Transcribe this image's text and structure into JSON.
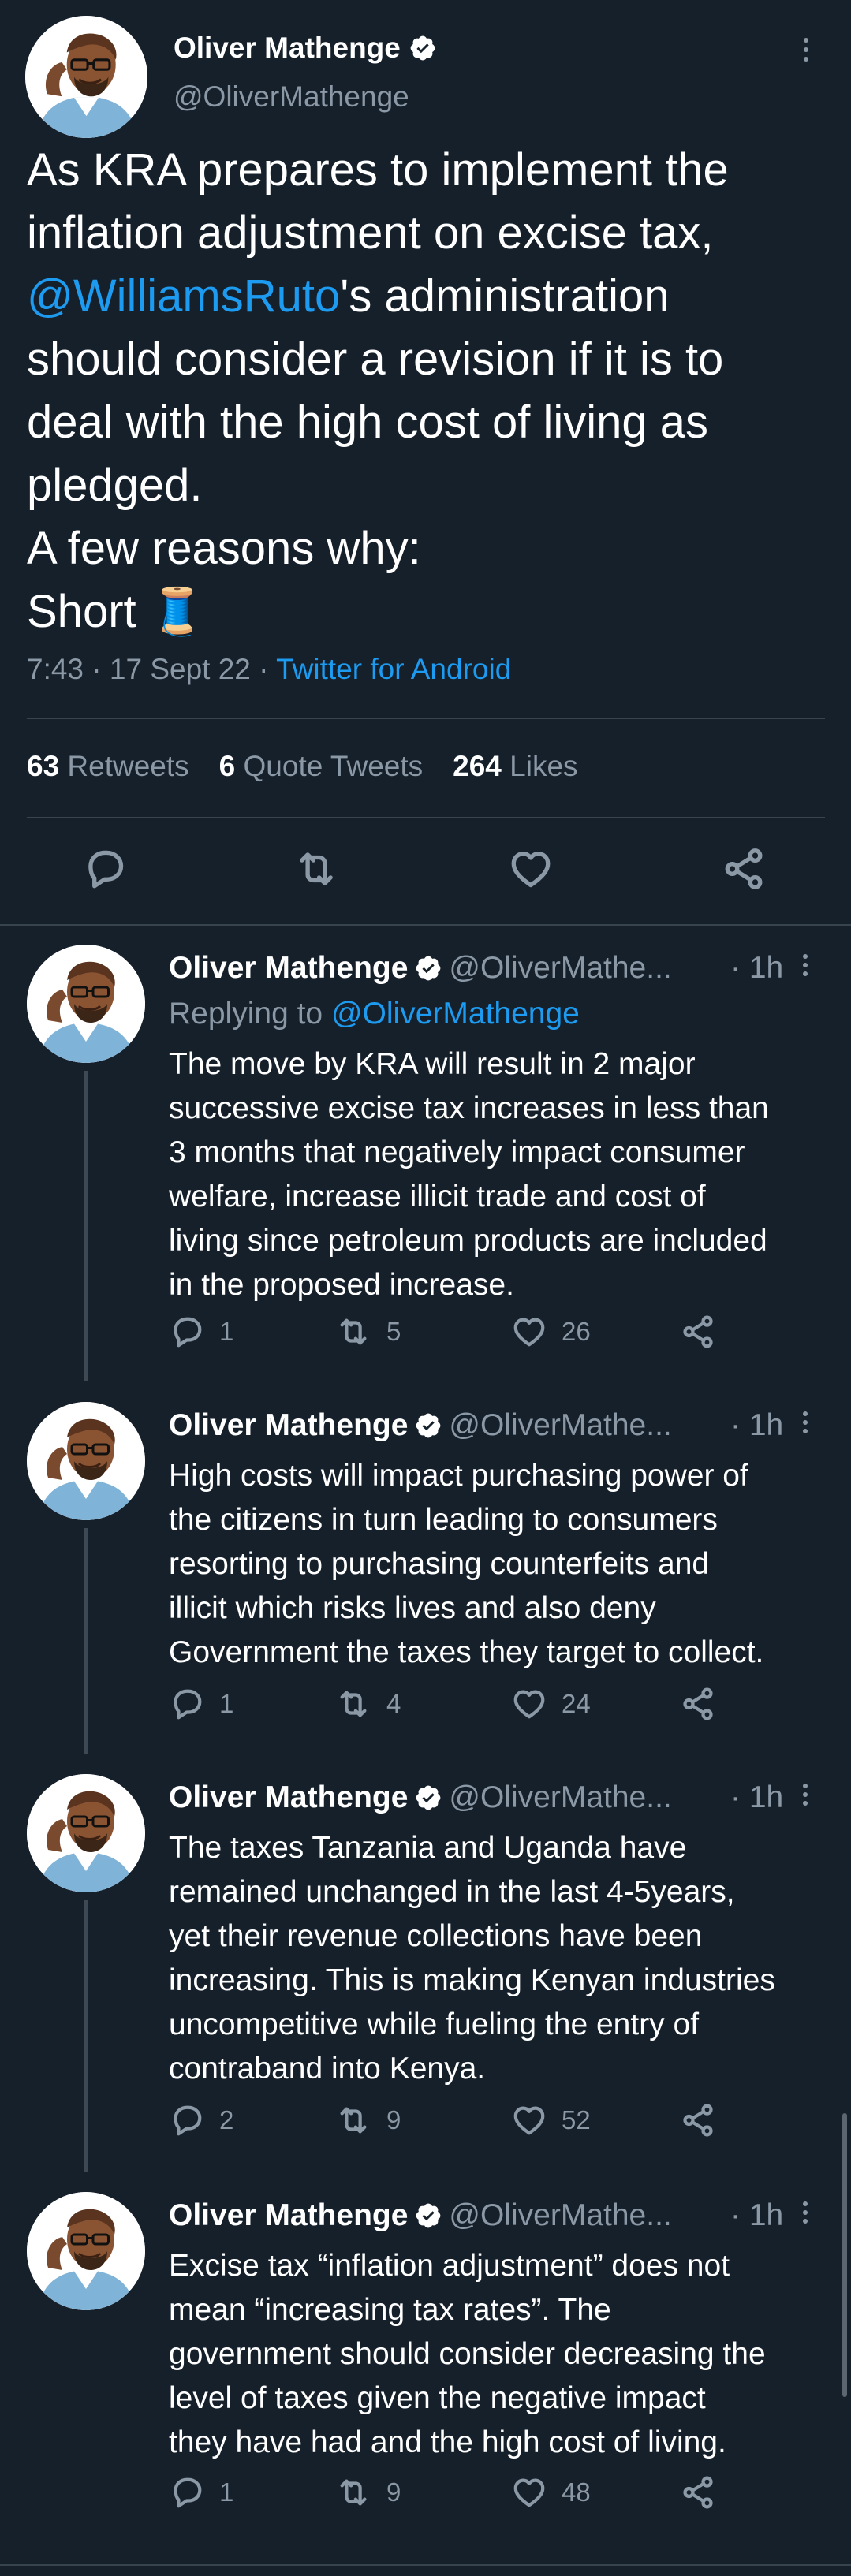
{
  "main_tweet": {
    "author_name": "Oliver Mathenge",
    "author_handle": "@OliverMathenge",
    "text_lines": [
      {
        "pre": "As KRA prepares to implement the",
        "mention": "",
        "post": ""
      },
      {
        "pre": "inflation adjustment on excise tax,",
        "mention": "",
        "post": ""
      },
      {
        "pre": "",
        "mention": "@WilliamsRuto",
        "post": "'s administration"
      },
      {
        "pre": "should consider a revision if it is to",
        "mention": "",
        "post": ""
      },
      {
        "pre": "deal with the high cost of living as",
        "mention": "",
        "post": ""
      },
      {
        "pre": "pledged.",
        "mention": "",
        "post": ""
      },
      {
        "pre": "A few reasons why:",
        "mention": "",
        "post": ""
      },
      {
        "pre": "Short 🧵",
        "mention": "",
        "post": ""
      }
    ],
    "time": "7:43 · 17 Sept 22 · ",
    "source": "Twitter for Android",
    "retweets_count": "63",
    "retweets_label": " Retweets",
    "quotes_count": "6",
    "quotes_label": " Quote Tweets",
    "likes_count": "264",
    "likes_label": " Likes"
  },
  "replies": [
    {
      "name": "Oliver Mathenge",
      "handle": "@OliverMathe...",
      "time": "· 1h",
      "replying_prefix": "Replying to ",
      "replying_to": "@OliverMathenge",
      "lines": [
        "The move by KRA will result in 2 major",
        "successive excise tax increases in less than",
        "3 months that negatively impact consumer",
        "welfare, increase illicit trade and cost of",
        "living since petroleum products are included",
        "in the proposed increase."
      ],
      "replies": "1",
      "retweets": "5",
      "likes": "26"
    },
    {
      "name": "Oliver Mathenge",
      "handle": "@OliverMathe...",
      "time": "· 1h",
      "lines": [
        "High costs will impact purchasing power of",
        "the citizens in turn leading to consumers",
        "resorting to purchasing counterfeits and",
        "illicit which risks lives and also deny",
        "Government the taxes they target to collect."
      ],
      "replies": "1",
      "retweets": "4",
      "likes": "24"
    },
    {
      "name": "Oliver Mathenge",
      "handle": "@OliverMathe...",
      "time": "· 1h",
      "lines": [
        "The taxes Tanzania and Uganda have",
        "remained unchanged in the last 4-5years,",
        "yet their revenue collections have been",
        "increasing. This is making Kenyan industries",
        "uncompetitive while fueling the entry of",
        "contraband into Kenya."
      ],
      "replies": "2",
      "retweets": "9",
      "likes": "52"
    },
    {
      "name": "Oliver Mathenge",
      "handle": "@OliverMathe...",
      "time": "· 1h",
      "lines": [
        "Excise tax “inflation adjustment” does not",
        "mean “increasing tax rates”. The",
        "government should consider decreasing the",
        "level of taxes given the negative impact",
        "they have had and the high cost of living."
      ],
      "replies": "1",
      "retweets": "9",
      "likes": "48"
    }
  ],
  "icons": {
    "reply": "reply-icon",
    "retweet": "retweet-icon",
    "like": "heart-icon",
    "share": "share-icon",
    "verified": "verified-badge-icon",
    "more": "more-options-icon"
  },
  "colors": {
    "background": "#15202b",
    "text": "#ffffff",
    "muted": "#8b98a5",
    "accent": "#1d9bf0",
    "divider": "#38444d"
  }
}
